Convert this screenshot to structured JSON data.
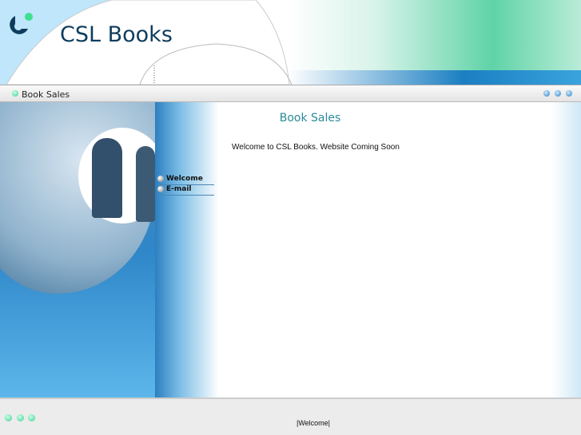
{
  "header": {
    "site_title": "CSL Books"
  },
  "navbar": {
    "title": "Book Sales"
  },
  "menu": [
    {
      "label": "Welcome"
    },
    {
      "label": "E-mail"
    }
  ],
  "content": {
    "title": "Book Sales",
    "text": "Welcome to CSL Books. Website Coming Soon"
  },
  "footer": {
    "link": "|Welcome|"
  },
  "colors": {
    "title": "#0e3d5c",
    "accent": "#2a8a9a",
    "green": "#3ecf8f"
  }
}
